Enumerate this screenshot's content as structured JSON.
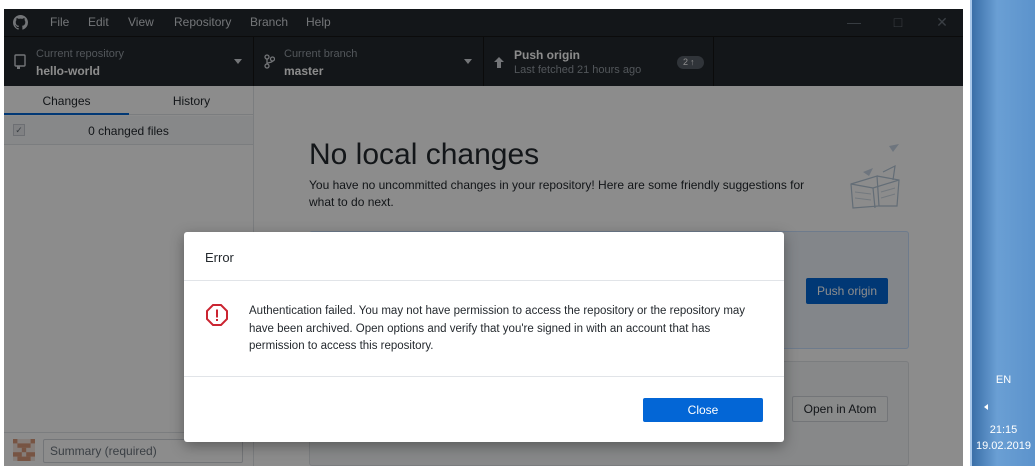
{
  "menu": [
    "File",
    "Edit",
    "View",
    "Repository",
    "Branch",
    "Help"
  ],
  "toolbar": {
    "repository": {
      "caption": "Current repository",
      "value": "hello-world"
    },
    "branch": {
      "caption": "Current branch",
      "value": "master"
    },
    "push": {
      "title": "Push origin",
      "subtitle": "Last fetched 21 hours ago",
      "badge": "2"
    }
  },
  "sidebar": {
    "tabs": [
      "Changes",
      "History"
    ],
    "changed_files": "0 changed files",
    "summary_placeholder": "Summary (required)"
  },
  "main": {
    "title": "No local changes",
    "description": "You have no uncommitted changes in your repository! Here are some friendly suggestions for what to do next.",
    "push_button": "Push origin",
    "atom_button": "Open in Atom"
  },
  "dialog": {
    "title": "Error",
    "message": "Authentication failed. You may not have permission to access the repository or the repository may have been archived. Open options and verify that you're signed in with an account that has permission to access this repository.",
    "close_button": "Close"
  },
  "taskbar": {
    "language": "EN",
    "time": "21:15",
    "date": "19.02.2019"
  },
  "colors": {
    "accent": "#0366d6",
    "error": "#cb2431",
    "chrome": "#24292e"
  }
}
